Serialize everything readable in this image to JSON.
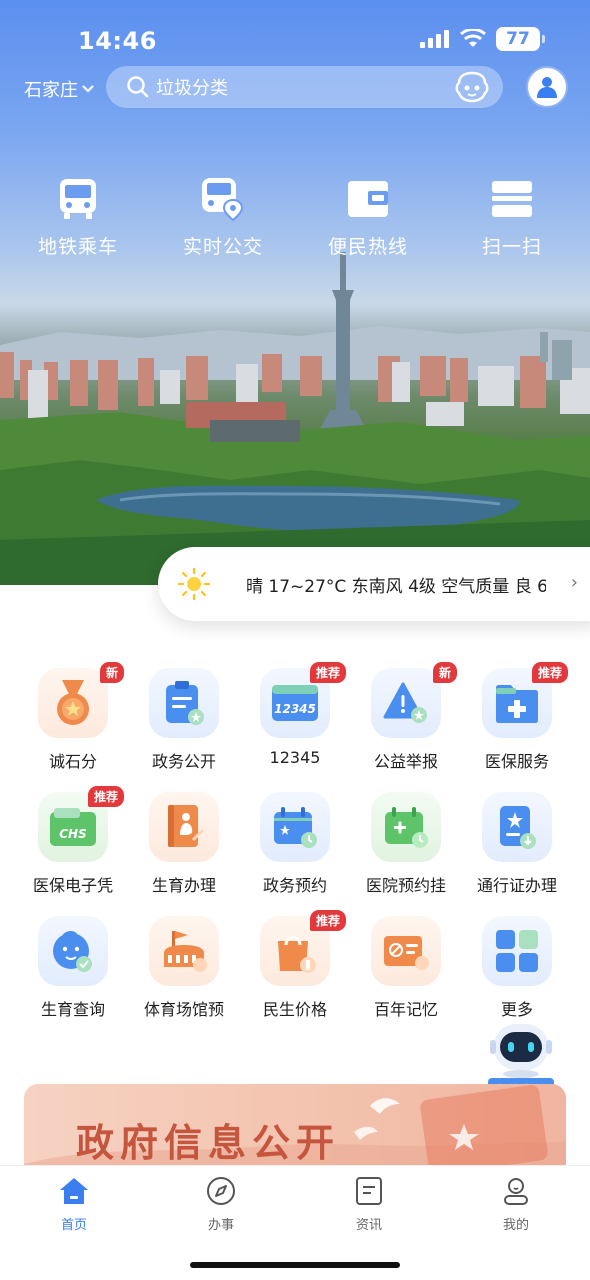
{
  "status_bar": {
    "time": "14:46",
    "battery": "77"
  },
  "header": {
    "city": "石家庄",
    "search_placeholder": "垃圾分类"
  },
  "quick_actions": [
    {
      "label": "地铁乘车",
      "icon": "bus-icon"
    },
    {
      "label": "实时公交",
      "icon": "bus-location-icon"
    },
    {
      "label": "便民热线",
      "icon": "wallet-icon"
    },
    {
      "label": "扫一扫",
      "icon": "scan-icon"
    }
  ],
  "weather": {
    "text": "晴 17~27°C 东南风 4级 空气质量 良 6"
  },
  "services": [
    {
      "label": "诚石分",
      "badge": "新",
      "icon": "medal-icon"
    },
    {
      "label": "政务公开",
      "badge": "",
      "icon": "clipboard-icon"
    },
    {
      "label": "12345",
      "badge": "推荐",
      "icon": "hotline-card-icon"
    },
    {
      "label": "公益举报",
      "badge": "新",
      "icon": "warning-icon"
    },
    {
      "label": "医保服务",
      "badge": "推荐",
      "icon": "medical-folder-icon"
    },
    {
      "label": "医保电子凭",
      "badge": "推荐",
      "icon": "chs-card-icon"
    },
    {
      "label": "生育办理",
      "badge": "",
      "icon": "maternity-book-icon"
    },
    {
      "label": "政务预约",
      "badge": "",
      "icon": "calendar-icon"
    },
    {
      "label": "医院预约挂",
      "badge": "",
      "icon": "hospital-calendar-icon"
    },
    {
      "label": "通行证办理",
      "badge": "",
      "icon": "pass-document-icon"
    },
    {
      "label": "生育查询",
      "badge": "",
      "icon": "baby-face-icon"
    },
    {
      "label": "体育场馆预",
      "badge": "",
      "icon": "stadium-icon"
    },
    {
      "label": "民生价格",
      "badge": "推荐",
      "icon": "shopping-bag-icon"
    },
    {
      "label": "百年记忆",
      "badge": "",
      "icon": "party-history-icon"
    },
    {
      "label": "更多",
      "badge": "",
      "icon": "grid-more-icon"
    }
  ],
  "robot": {
    "label": "智能客服"
  },
  "banner": {
    "title": "政府信息公开"
  },
  "tabs": [
    {
      "label": "首页",
      "active": true
    },
    {
      "label": "办事",
      "active": false
    },
    {
      "label": "资讯",
      "active": false
    },
    {
      "label": "我的",
      "active": false
    }
  ],
  "colors": {
    "accent": "#3a7ef0",
    "badge": "#e4393c",
    "sky": "#5b8ff0"
  }
}
